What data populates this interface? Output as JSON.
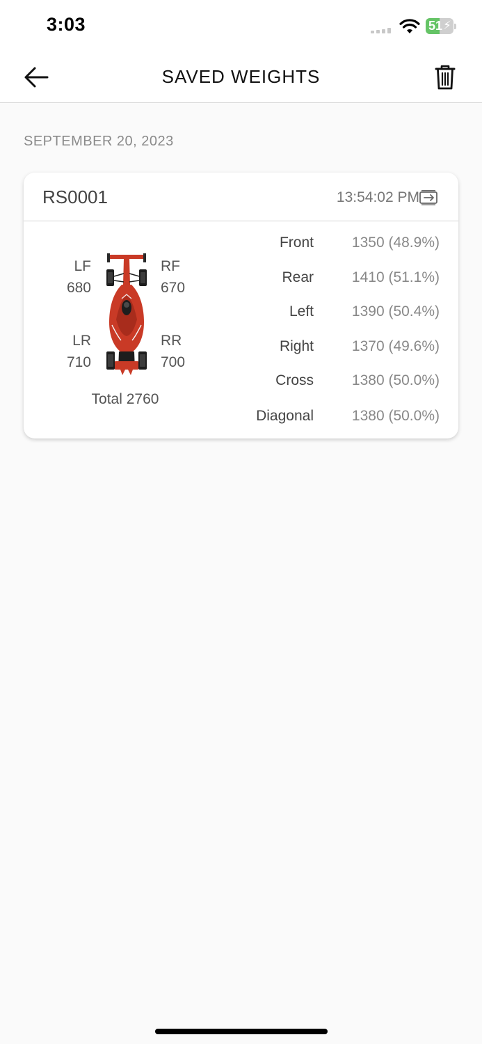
{
  "status_bar": {
    "time": "3:03",
    "battery": "51"
  },
  "nav": {
    "title": "SAVED WEIGHTS"
  },
  "date_header": "SEPTEMBER 20, 2023",
  "record": {
    "id": "RS0001",
    "time": "13:54:02 PM",
    "corners": {
      "lf": {
        "label": "LF",
        "value": "680"
      },
      "rf": {
        "label": "RF",
        "value": "670"
      },
      "lr": {
        "label": "LR",
        "value": "710"
      },
      "rr": {
        "label": "RR",
        "value": "700"
      }
    },
    "total": "Total 2760",
    "stats": [
      {
        "label": "Front",
        "value": "1350 (48.9%)"
      },
      {
        "label": "Rear",
        "value": "1410 (51.1%)"
      },
      {
        "label": "Left",
        "value": "1390 (50.4%)"
      },
      {
        "label": "Right",
        "value": "1370 (49.6%)"
      },
      {
        "label": "Cross",
        "value": "1380 (50.0%)"
      },
      {
        "label": "Diagonal",
        "value": "1380 (50.0%)"
      }
    ]
  },
  "icons": {
    "back": "arrow-left-icon",
    "delete": "trash-icon",
    "export": "export-icon",
    "car": "race-car-icon"
  },
  "colors": {
    "car_red": "#c93a26",
    "battery_green": "#65c466"
  }
}
